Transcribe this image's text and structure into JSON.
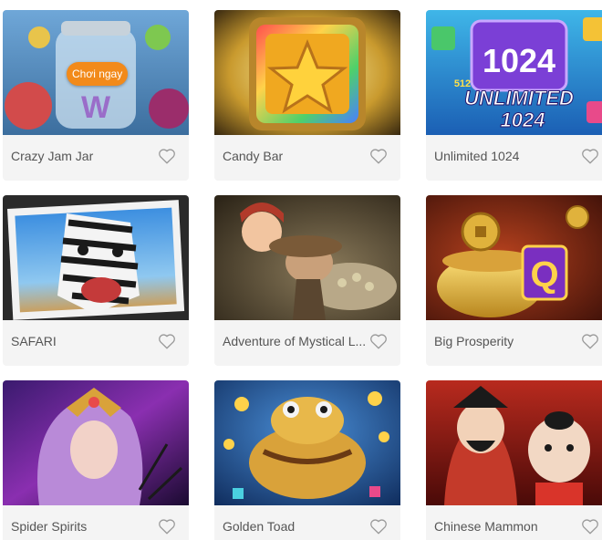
{
  "games": [
    {
      "title": "Crazy Jam Jar",
      "image": "jam-jar-art",
      "play_label": "Chơi ngay"
    },
    {
      "title": "Candy Bar",
      "image": "star-tile-art"
    },
    {
      "title": "Unlimited 1024",
      "image": "unlimited-1024-art",
      "art_text": {
        "top": "1024",
        "mid": "UNLIMITED",
        "bottom": "1024",
        "badge": "512"
      }
    },
    {
      "title": "SAFARI",
      "image": "zebra-art"
    },
    {
      "title": "Adventure of Mystical L...",
      "image": "explorers-treasure-art"
    },
    {
      "title": "Big Prosperity",
      "image": "gold-pot-art",
      "art_text": {
        "letter": "Q"
      }
    },
    {
      "title": "Spider Spirits",
      "image": "spider-queen-art"
    },
    {
      "title": "Golden Toad",
      "image": "golden-toad-art"
    },
    {
      "title": "Chinese Mammon",
      "image": "god-of-wealth-art"
    }
  ],
  "icons": {
    "favorite": "heart-outline-icon"
  },
  "colors": {
    "card_bg": "#f4f4f4",
    "title_text": "#555555",
    "heart_stroke": "#999999",
    "play_badge": "#f28a1a"
  }
}
